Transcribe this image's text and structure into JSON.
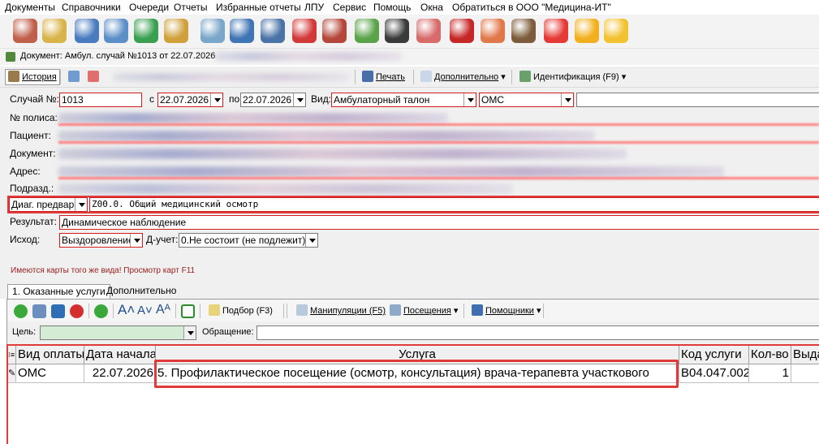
{
  "menu": [
    "Документы",
    "Справочники",
    "Очереди",
    "Отчеты",
    "Избранные отчеты",
    "ЛПУ",
    "Сервис",
    "Помощь",
    "Окна",
    "Обратиться в ООО \"Медицина-ИТ\""
  ],
  "toolbar_icons": [
    {
      "name": "doctor-icon",
      "color": "#c0604a"
    },
    {
      "name": "journal-icon",
      "color": "#d9b44a"
    },
    {
      "name": "registry-icon",
      "color": "#4a7bbf"
    },
    {
      "name": "patient-card-icon",
      "color": "#5c8fc7"
    },
    {
      "name": "stethoscope-book-icon",
      "color": "#3aa050"
    },
    {
      "name": "notepad-icon",
      "color": "#cfa13a"
    },
    {
      "name": "syringe-icon",
      "color": "#7aa6c9"
    },
    {
      "name": "calendar-people-icon",
      "color": "#3f74b5"
    },
    {
      "name": "lab-search-icon",
      "color": "#4a74a8"
    },
    {
      "name": "medical-book-icon",
      "color": "#d23a3a"
    },
    {
      "name": "books-icon",
      "color": "#b5473a"
    },
    {
      "name": "pills-icon",
      "color": "#5aa34a"
    },
    {
      "name": "barcode-scanner-icon",
      "color": "#3a3a3a"
    },
    {
      "name": "nurse-icon",
      "color": "#d86a6a"
    },
    {
      "name": "red-book-icon",
      "color": "#c62828"
    },
    {
      "name": "schedule-icon",
      "color": "#e0784a"
    },
    {
      "name": "wallet-icon",
      "color": "#7c5c3a"
    },
    {
      "name": "apps-icon",
      "color": "#e53935"
    },
    {
      "name": "lock-icon",
      "color": "#f2b01e"
    },
    {
      "name": "chat-icon",
      "color": "#f2c230"
    }
  ],
  "document": {
    "title": "Документ: Амбул. случай №1013 от 22.07.2026"
  },
  "doc_toolbar": {
    "history": "История",
    "print": "Печать",
    "extra": "Дополнительно",
    "identification": "Идентификация (F9)"
  },
  "form": {
    "case_label": "Случай №:",
    "case_value": "1013",
    "from_label": "с",
    "from_value": "22.07.2026",
    "to_label": "по",
    "to_value": "22.07.2026",
    "type_label": "Вид:",
    "type_value": "Амбулаторный талон",
    "payment_value": "ОМС",
    "policy_label": "№ полиса:",
    "patient_label": "Пациент:",
    "doc_label": "Документ:",
    "address_label": "Адрес:",
    "dept_label": "Подразд.:",
    "diag_type": "Диаг. предвар.",
    "diag_value": "Z00.0. Общий медицинский осмотр",
    "result_label": "Результат:",
    "result_value": "Динамическое наблюдение",
    "outcome_label": "Исход:",
    "outcome_value": "Выздоровление",
    "dreg_label": "Д-учет:",
    "dreg_value": "0.Не состоит (не подлежит)",
    "warning": "Имеются карты того же вида! Просмотр карт F11"
  },
  "tabs": [
    "1. Оказанные услуги",
    "Дополнительно"
  ],
  "svc_toolbar": {
    "selection": "Подбор (F3)",
    "manipulations": "Манипуляции (F5)",
    "visits": "Посещения",
    "helpers": "Помощники"
  },
  "goal": {
    "goal_label": "Цель:",
    "appeal_label": "Обращение:"
  },
  "grid": {
    "columns": [
      "Вид оплаты",
      "Дата начала",
      "Услуга",
      "Код услуги",
      "Кол-во",
      "Выда"
    ],
    "rows": [
      [
        "ОМС",
        "22.07.2026",
        "5. Профилактическое посещение (осмотр, консультация) врача-терапевта участкового",
        "B04.047.002",
        "1",
        ""
      ]
    ]
  },
  "colors": {
    "required_border": "#d21b1b",
    "highlight": "#e03a3a",
    "warning_text": "#9c1b1b"
  }
}
